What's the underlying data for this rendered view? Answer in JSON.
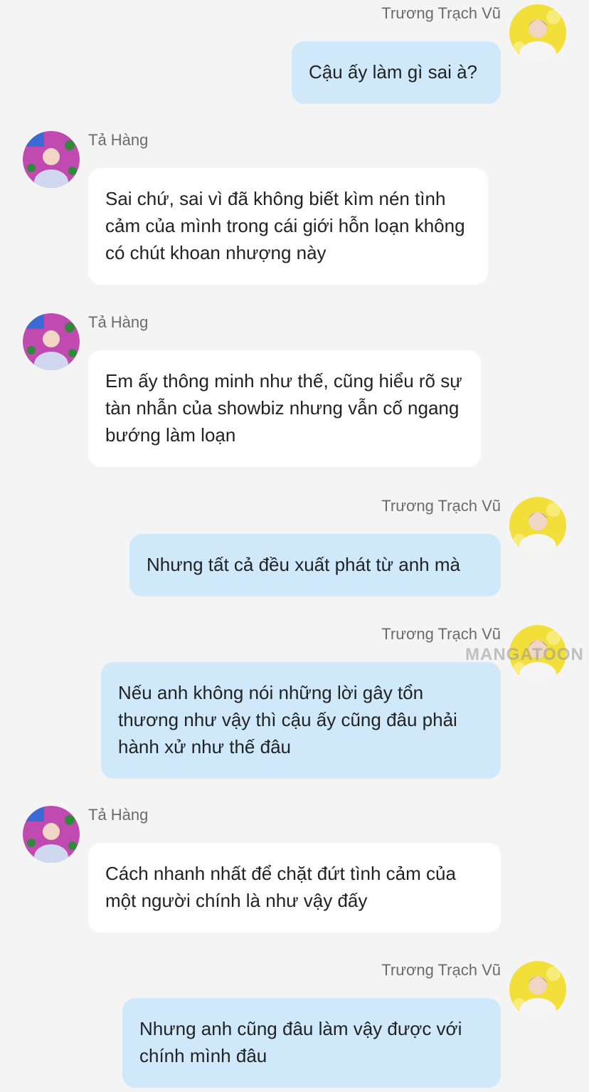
{
  "messages": [
    {
      "sender": "Trương Trạch Vũ",
      "side": "right",
      "text": "Cậu ấy làm gì sai à?"
    },
    {
      "sender": "Tả Hàng",
      "side": "left",
      "text": "Sai chứ, sai vì đã không biết kìm nén tình cảm của mình trong cái giới hỗn loạn không có chút khoan nhượng này"
    },
    {
      "sender": "Tả Hàng",
      "side": "left",
      "text": "Em ấy thông minh như thế, cũng hiểu rõ sự tàn nhẫn của showbiz nhưng vẫn cố ngang bướng làm loạn"
    },
    {
      "sender": "Trương Trạch Vũ",
      "side": "right",
      "text": "Nhưng tất cả đều xuất phát từ anh mà"
    },
    {
      "sender": "Trương Trạch Vũ",
      "side": "right",
      "text": "Nếu anh không nói những lời gây tổn thương như vậy thì cậu ấy cũng đâu phải hành xử như thế đâu"
    },
    {
      "sender": "Tả Hàng",
      "side": "left",
      "text": "Cách nhanh nhất để chặt đứt tình cảm của một người chính là như vậy đấy"
    },
    {
      "sender": "Trương Trạch Vũ",
      "side": "right",
      "text": "Nhưng anh cũng đâu làm vậy được với chính mình đâu"
    }
  ],
  "watermark": "MANGATOON",
  "colors": {
    "background": "#f4f4f4",
    "bubble_left": "#ffffff",
    "bubble_right": "#cfe9fb",
    "avatar_left": "#c04ab0",
    "avatar_right": "#f2df3a"
  },
  "icons": {
    "left_avatar": "avatar-ta-hang",
    "right_avatar": "avatar-truong-trach-vu"
  }
}
